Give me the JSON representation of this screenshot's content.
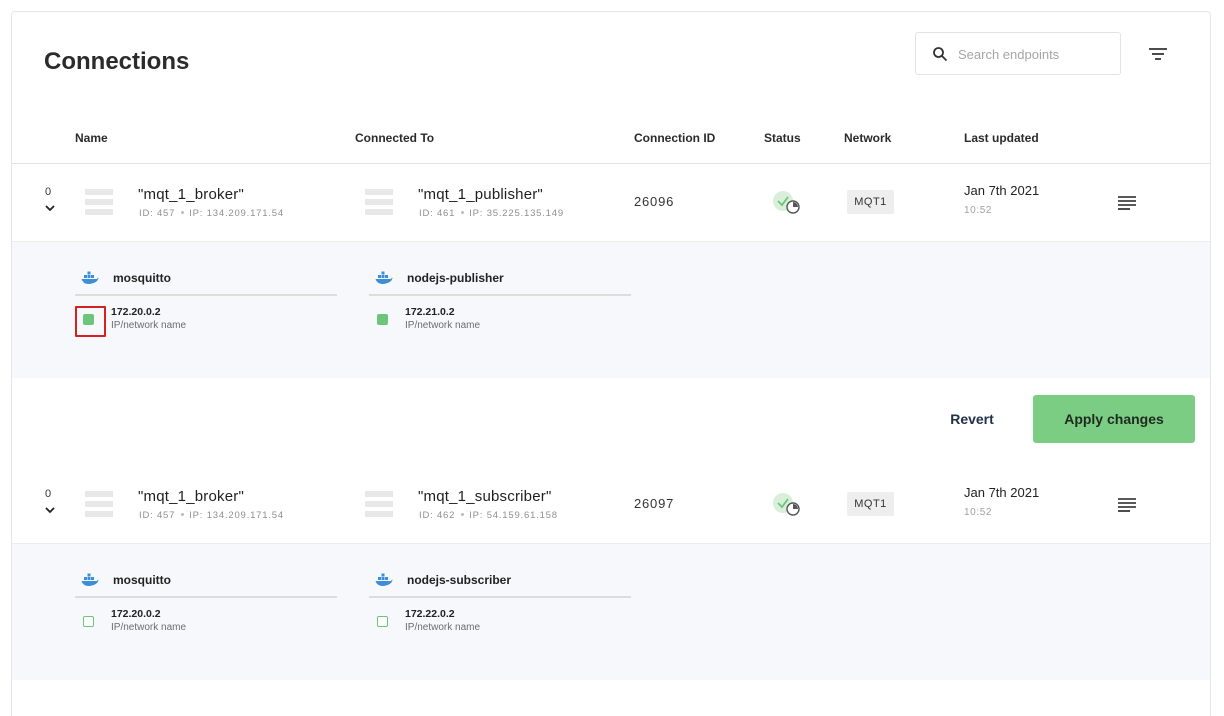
{
  "page": {
    "title": "Connections"
  },
  "search": {
    "placeholder": "Search endpoints",
    "value": ""
  },
  "columns": {
    "name": "Name",
    "connected_to": "Connected To",
    "connection_id": "Connection ID",
    "status": "Status",
    "network": "Network",
    "last_updated": "Last updated"
  },
  "connections": [
    {
      "count": "0",
      "source": {
        "name": "\"mqt_1_broker\"",
        "id": "ID: 457",
        "ip": "IP: 134.209.171.54"
      },
      "target": {
        "name": "\"mqt_1_publisher\"",
        "id": "ID: 461",
        "ip": "IP: 35.225.135.149"
      },
      "connection_id": "26096",
      "network": "MQT1",
      "date": "Jan 7th 2021",
      "time": "10:52",
      "containers": [
        {
          "name": "mosquitto",
          "ip": "172.20.0.2",
          "label": "IP/network name",
          "checked": true
        },
        {
          "name": "nodejs-publisher",
          "ip": "172.21.0.2",
          "label": "IP/network name",
          "checked": true
        }
      ]
    },
    {
      "count": "0",
      "source": {
        "name": "\"mqt_1_broker\"",
        "id": "ID: 457",
        "ip": "IP: 134.209.171.54"
      },
      "target": {
        "name": "\"mqt_1_subscriber\"",
        "id": "ID: 462",
        "ip": "IP: 54.159.61.158"
      },
      "connection_id": "26097",
      "network": "MQT1",
      "date": "Jan 7th 2021",
      "time": "10:52",
      "containers": [
        {
          "name": "mosquitto",
          "ip": "172.20.0.2",
          "label": "IP/network name",
          "checked": false
        },
        {
          "name": "nodejs-subscriber",
          "ip": "172.22.0.2",
          "label": "IP/network name",
          "checked": false
        }
      ]
    }
  ],
  "actions": {
    "revert": "Revert",
    "apply": "Apply changes"
  },
  "colors": {
    "accent_green": "#7ccd84",
    "check_green": "#6cc57a",
    "focus_red": "#d32222"
  },
  "icons": [
    "search-icon",
    "filter-icon",
    "chevron-down-icon",
    "list-icon",
    "status-check-icon",
    "menu-icon",
    "docker-icon"
  ]
}
